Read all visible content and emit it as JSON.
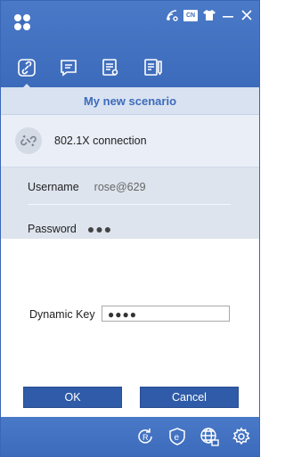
{
  "header": {
    "logo_icon": "app-logo-icon",
    "window_icons": [
      "wifi-settings-icon",
      "language-cn-icon",
      "shirt-skin-icon",
      "minimize-icon",
      "close-icon"
    ],
    "language_badge": "CN"
  },
  "tabs": [
    {
      "icon": "connection-icon",
      "active": true
    },
    {
      "icon": "message-icon",
      "active": false
    },
    {
      "icon": "list-icon",
      "active": false
    },
    {
      "icon": "notes-icon",
      "active": false
    }
  ],
  "scenario": {
    "title": "My new scenario"
  },
  "connection": {
    "label": "802.1X connection",
    "icon": "broken-link-icon"
  },
  "credentials": {
    "username_label": "Username",
    "username_value": "rose@629",
    "password_label": "Password",
    "password_value": "●●●"
  },
  "dialog": {
    "dynamic_key_label": "Dynamic Key",
    "dynamic_key_value": "●●●●",
    "ok_label": "OK",
    "cancel_label": "Cancel"
  },
  "footer": {
    "icons": [
      "refresh-r-icon",
      "e-shield-icon",
      "globe-network-icon",
      "settings-gear-icon"
    ]
  },
  "colors": {
    "brand_blue": "#3d6bbb",
    "button_blue": "#2f5ba8",
    "scenario_bg": "#d9e2f1"
  }
}
